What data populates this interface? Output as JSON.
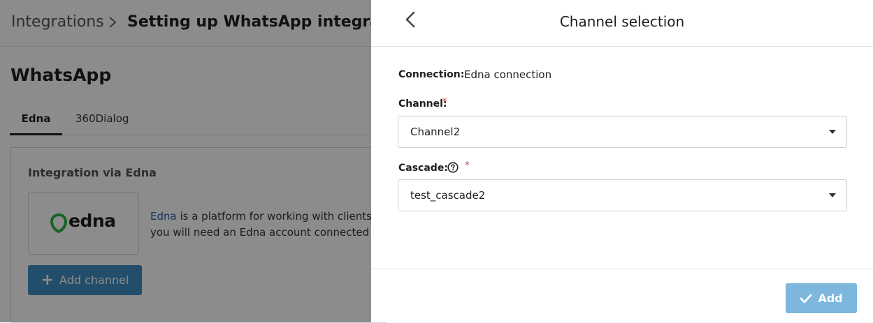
{
  "background": {
    "breadcrumb": {
      "root": "Integrations",
      "current": "Setting up WhatsApp integration"
    },
    "page_title": "WhatsApp",
    "tabs": [
      {
        "label": "Edna",
        "active": true
      },
      {
        "label": "360Dialog",
        "active": false
      }
    ],
    "card": {
      "title": "Integration via Edna",
      "logo_text": "edna",
      "description_link": "Edna",
      "description_line1_rest": " is a platform for working with clients in c",
      "description_line2": "you will need an Edna account connected to A",
      "add_channel_label": "Add channel"
    }
  },
  "panel": {
    "title": "Channel selection",
    "connection_label": "Connection:",
    "connection_value": "Edna connection",
    "channel": {
      "label": "Channel:",
      "required_mark": "*",
      "value": "Channel2"
    },
    "cascade": {
      "label": "Cascade:",
      "required_mark": "*",
      "value": "test_cascade2"
    },
    "add_label": "Add"
  },
  "colors": {
    "primary_button": "#3f8fc4",
    "add_button": "#7db7dd",
    "required": "#d13a3a",
    "link": "#2a5db0"
  },
  "icons": [
    "chevron-right-icon",
    "chevron-left-icon",
    "help-icon",
    "caret-down-icon",
    "plus-icon",
    "check-icon",
    "edna-logo-icon"
  ]
}
